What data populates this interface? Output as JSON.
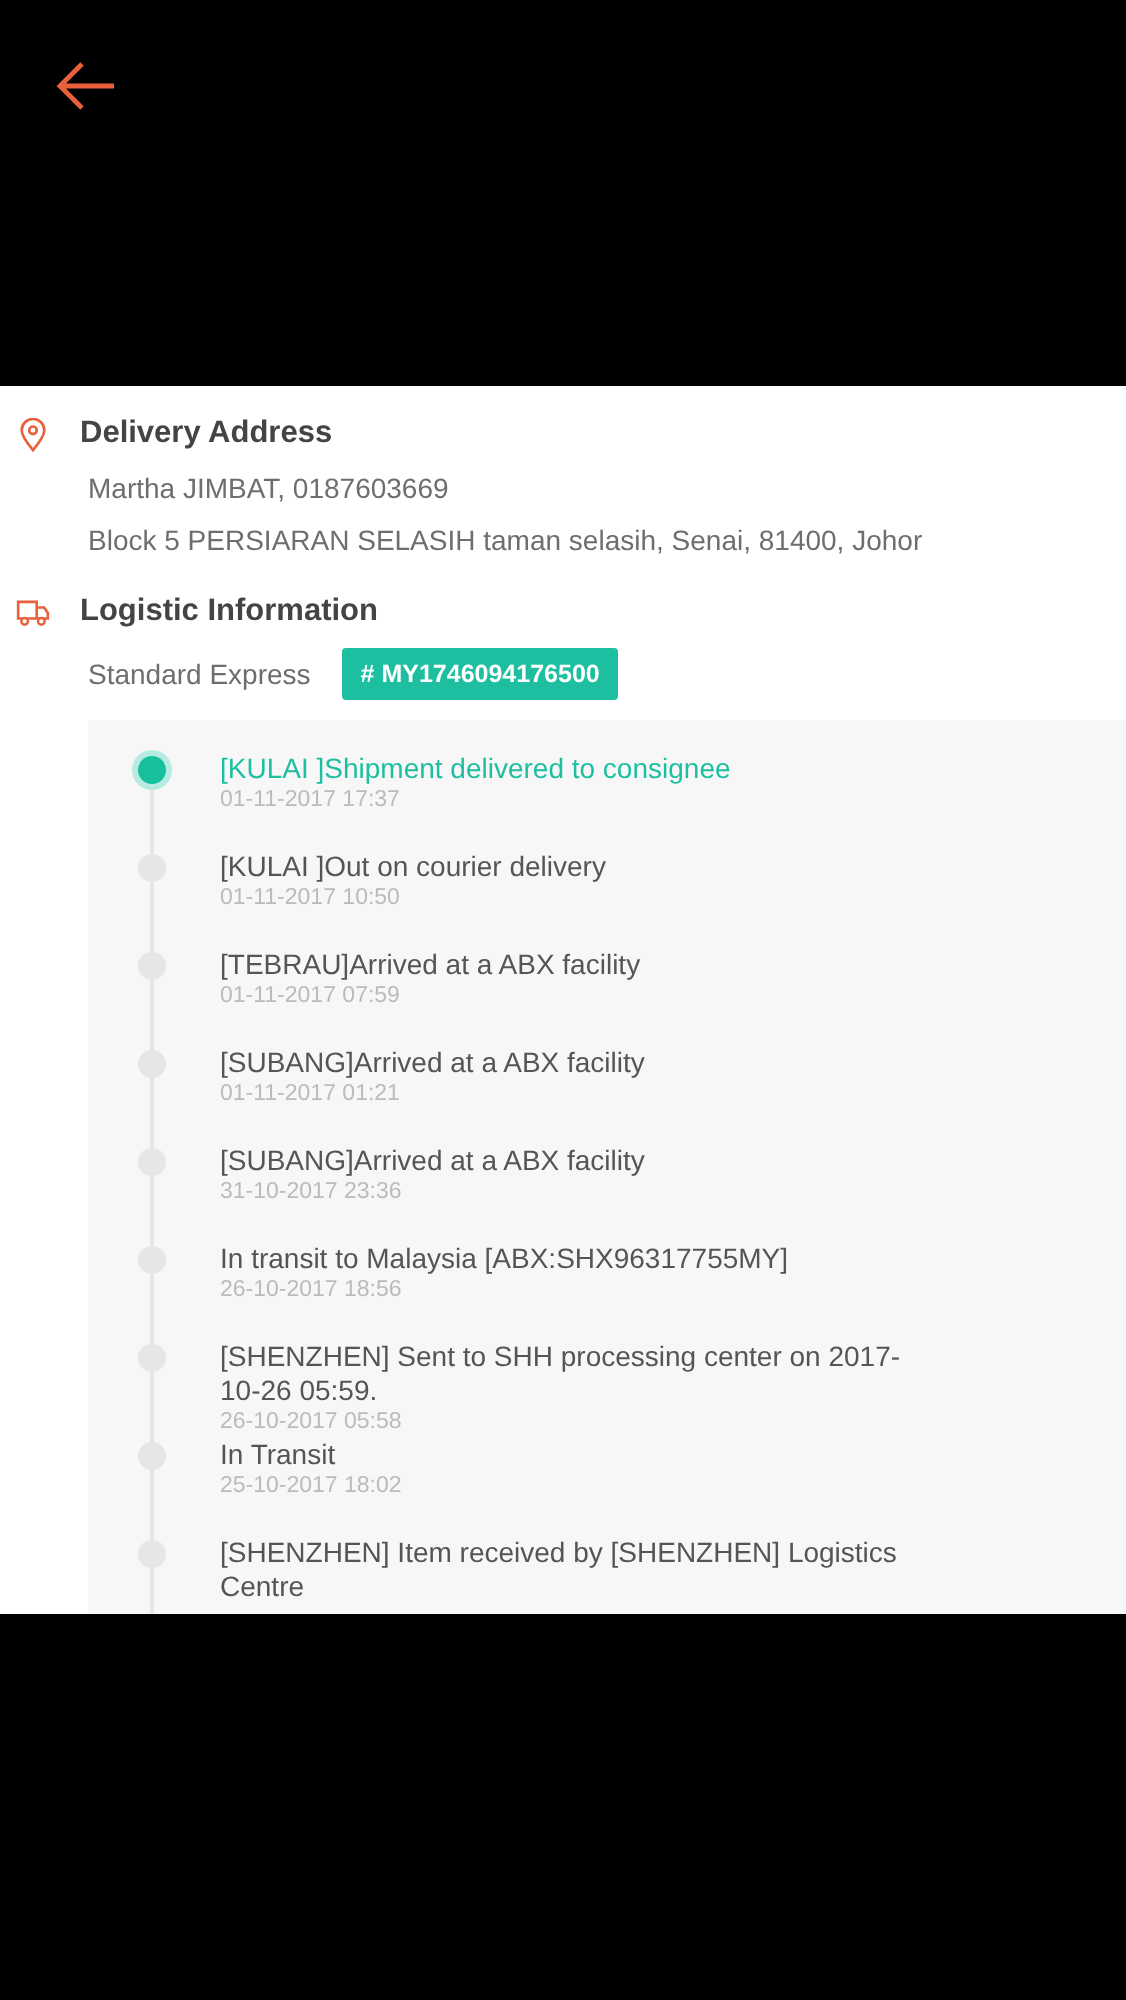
{
  "delivery_address": {
    "title": "Delivery Address",
    "name_phone": "Martha JIMBAT, 0187603669",
    "address": "Block 5 PERSIARAN SELASIH taman selasih, Senai, 81400, Johor"
  },
  "logistic_information": {
    "title": "Logistic Information",
    "service": "Standard Express",
    "tracking_number": "# MY1746094176500"
  },
  "tracking_events": [
    {
      "status": "[KULAI ]Shipment delivered to consignee",
      "time": "01-11-2017 17:37",
      "current": true
    },
    {
      "status": "[KULAI ]Out on courier delivery",
      "time": "01-11-2017 10:50",
      "current": false
    },
    {
      "status": "[TEBRAU]Arrived at a ABX facility",
      "time": "01-11-2017 07:59",
      "current": false
    },
    {
      "status": "[SUBANG]Arrived at a ABX facility",
      "time": "01-11-2017 01:21",
      "current": false
    },
    {
      "status": "[SUBANG]Arrived at a ABX facility",
      "time": "31-10-2017 23:36",
      "current": false
    },
    {
      "status": "In transit to Malaysia [ABX:SHX96317755MY]",
      "time": "26-10-2017 18:56",
      "current": false
    },
    {
      "status": "[SHENZHEN] Sent to SHH processing center on 2017-10-26 05:59.",
      "time": "26-10-2017 05:58",
      "current": false
    },
    {
      "status": "In Transit",
      "time": "25-10-2017 18:02",
      "current": false
    },
    {
      "status": "[SHENZHEN] Item received by [SHENZHEN] Logistics Centre",
      "current": false
    }
  ]
}
